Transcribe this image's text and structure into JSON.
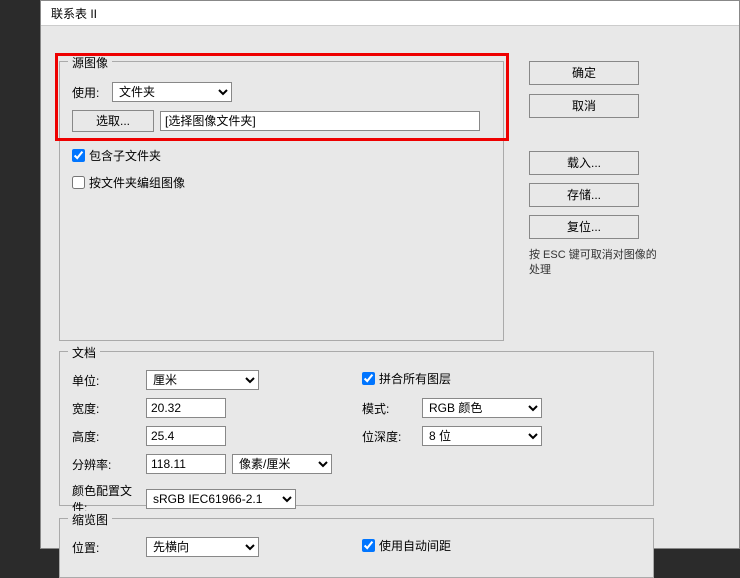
{
  "title": "联系表 II",
  "source": {
    "legend": "源图像",
    "use_label": "使用:",
    "use_value": "文件夹",
    "choose_btn": "选取...",
    "path_value": "[选择图像文件夹]",
    "include_sub": "包含子文件夹",
    "group_by_folder": "按文件夹编组图像"
  },
  "sidebar": {
    "ok": "确定",
    "cancel": "取消",
    "load": "载入...",
    "save": "存储...",
    "reset": "复位...",
    "hint": "按 ESC 键可取消对图像的处理"
  },
  "doc": {
    "legend": "文档",
    "units_label": "单位:",
    "units_value": "厘米",
    "width_label": "宽度:",
    "width_value": "20.32",
    "height_label": "高度:",
    "height_value": "25.4",
    "res_label": "分辨率:",
    "res_value": "118.11",
    "res_units": "像素/厘米",
    "profile_label": "颜色配置文件:",
    "profile_value": "sRGB IEC61966-2.1",
    "flatten": "拼合所有图层",
    "mode_label": "模式:",
    "mode_value": "RGB 颜色",
    "depth_label": "位深度:",
    "depth_value": "8 位"
  },
  "thumb": {
    "legend": "缩览图",
    "placement_label": "位置:",
    "placement_value": "先横向",
    "auto_spacing": "使用自动间距"
  }
}
